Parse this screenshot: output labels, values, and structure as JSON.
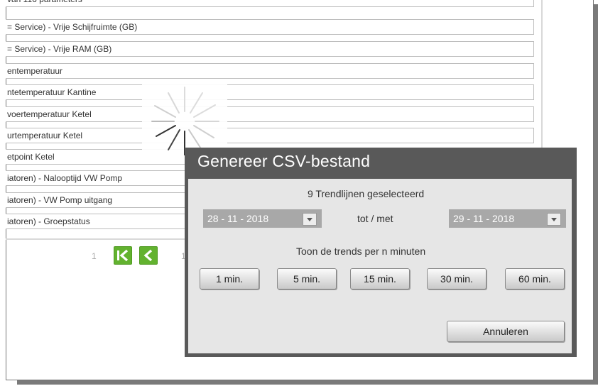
{
  "params": {
    "rows": [
      "van 116 parameters",
      "= Service) - Vrije Schijfruimte (GB)",
      "= Service) - Vrije RAM (GB)",
      "entemperatuur",
      "ntetemperatuur Kantine",
      "voertemperatuur Ketel",
      "urtemperatuur Ketel",
      "etpoint Ketel",
      "iatoren) - Nalooptijd VW Pomp",
      "iatoren) - VW Pomp uitgang",
      "iatoren) - Groepstatus"
    ]
  },
  "pagination": {
    "left_num": "1",
    "right_num": "1",
    "first_icon": "first-page-icon",
    "prev_icon": "prev-page-icon",
    "color": "#62b22f"
  },
  "spinner": {
    "icon": "loading-spinner-icon"
  },
  "dialog": {
    "title": "Genereer CSV-bestand",
    "selected_text": "9 Trendlijnen geselecteerd",
    "from_date": "28 - 11 -  2018",
    "to_label": "tot / met",
    "to_date": "29 - 11 -  2018",
    "interval_label": "Toon de trends per n minuten",
    "interval_buttons": [
      "1 min.",
      "5 min.",
      "15 min.",
      "30 min.",
      "60 min."
    ],
    "cancel_label": "Annuleren",
    "header_color": "#595959"
  }
}
